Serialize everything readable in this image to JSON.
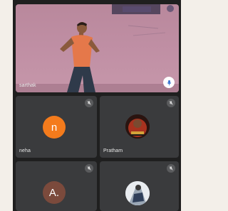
{
  "main_speaker": {
    "name": "sarthak",
    "mic_icon": "mic-icon"
  },
  "participants": [
    {
      "name": "neha",
      "avatar_letter": "n",
      "avatar_color": "#f47b1c",
      "muted": true
    },
    {
      "name": "Pratham",
      "avatar": "profile-photo",
      "muted": true
    },
    {
      "name": "",
      "avatar_letter": "A.",
      "avatar_color": "#7b4a3c",
      "muted": true
    },
    {
      "name": "",
      "avatar": "profile-photo",
      "muted": true
    }
  ],
  "colors": {
    "background": "#1f1f1f",
    "tile": "#3a3b3d",
    "accent_orange": "#f47b1c"
  }
}
